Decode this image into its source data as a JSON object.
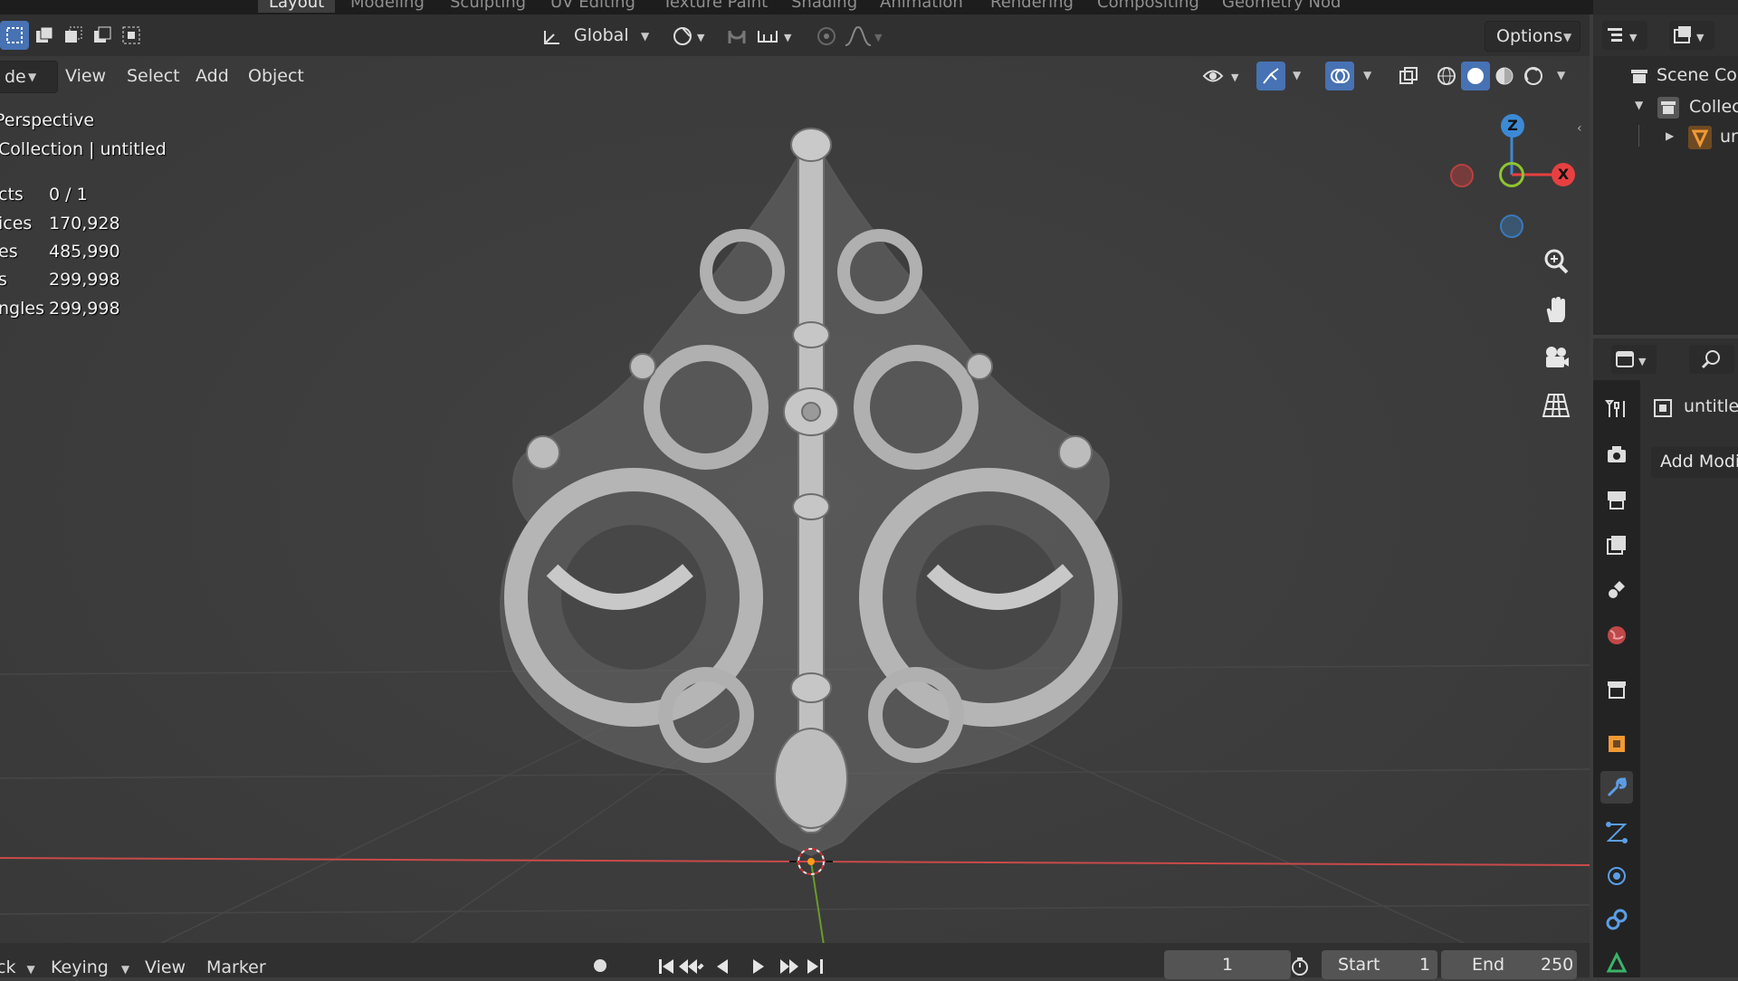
{
  "workspace_tabs": [
    "Layout",
    "Modeling",
    "Sculpting",
    "UV Editing",
    "Texture Paint",
    "Shading",
    "Animation",
    "Rendering",
    "Compositing",
    "Geometry Nod"
  ],
  "toolbar": {
    "transform_orientation": "Global",
    "options_label": "Options"
  },
  "viewport_menu": {
    "mode_label": "de",
    "items": [
      "View",
      "Select",
      "Add",
      "Object"
    ]
  },
  "overlay": {
    "view_name": "Perspective",
    "collection_line": "Collection | untitled",
    "stats": [
      {
        "label": "cts",
        "value": "0 / 1"
      },
      {
        "label": "ices",
        "value": "170,928"
      },
      {
        "label": "es",
        "value": "485,990"
      },
      {
        "label": "s",
        "value": "299,998"
      },
      {
        "label": "ngles",
        "value": "299,998"
      }
    ]
  },
  "gizmo": {
    "z_label": "Z",
    "x_label": "X"
  },
  "outliner": {
    "scene_collection": "Scene Col",
    "collection": "Collec",
    "object": "ur"
  },
  "properties": {
    "object_name": "untitle",
    "add_modifier": "Add Modif"
  },
  "timeline": {
    "mode_label": "ck",
    "keying": "Keying",
    "view": "View",
    "marker": "Marker",
    "current_frame": "1",
    "start_label": "Start",
    "start_value": "1",
    "end_label": "End",
    "end_value": "250"
  },
  "colors": {
    "accent": "#4772b3",
    "axis_x": "#e84040",
    "axis_y": "#8ec431",
    "axis_z": "#3c8ad4"
  }
}
